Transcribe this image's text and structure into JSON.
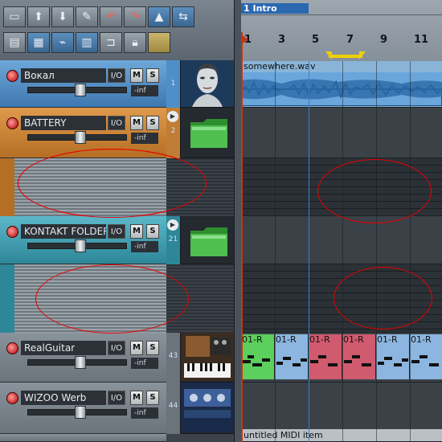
{
  "toolbar": {
    "row1": [
      "add-track-icon",
      "import-icon",
      "render-icon",
      "wrench-icon",
      "undo-icon",
      "redo-icon",
      "metronome-icon",
      "grid-snap-icon"
    ],
    "row2": [
      "mixer-icon",
      "grid-icon",
      "routing-icon",
      "keyboard-icon",
      "loop-icon",
      "lock-icon",
      "color-swatch-icon"
    ]
  },
  "tracks": [
    {
      "name": "Вокал",
      "io": "I/O",
      "mute": "M",
      "solo": "S",
      "volume": "-inf",
      "number": "1",
      "color": "blue"
    },
    {
      "name": "BATTERY",
      "io": "I/O",
      "mute": "M",
      "solo": "S",
      "volume": "-inf",
      "number": "2",
      "color": "orange"
    },
    {
      "name": "KONTAKT FOLDER",
      "io": "I/O",
      "mute": "M",
      "solo": "S",
      "volume": "-inf",
      "number": "21",
      "color": "teal"
    },
    {
      "name": "RealGuitar",
      "io": "I/O",
      "mute": "M",
      "solo": "S",
      "volume": "-inf",
      "number": "43",
      "color": "gray"
    },
    {
      "name": "WIZOO Werb",
      "io": "I/O",
      "mute": "M",
      "solo": "S",
      "volume": "-inf",
      "number": "44",
      "color": "gray"
    }
  ],
  "arrange": {
    "region_name": "1 Intro",
    "ticks": [
      "1",
      "3",
      "5",
      "7",
      "9",
      "11"
    ],
    "wav_item": "somewhere.wav",
    "midi_items": [
      "01-R",
      "01-R",
      "01-R",
      "01-R",
      "01-R",
      "01-R"
    ],
    "midi_bottom": "untitled MIDI item"
  }
}
